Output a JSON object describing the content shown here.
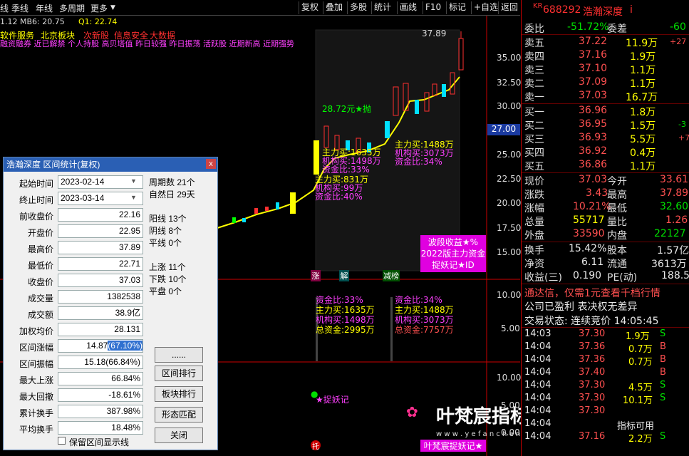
{
  "topbar": {
    "left_items": [
      "线",
      "季线",
      "年线",
      "多周期",
      "更多"
    ],
    "buttons": [
      "复权",
      "叠加",
      "多股",
      "统计",
      "画线",
      "F10",
      "标记",
      "+自选",
      "返回"
    ]
  },
  "chart": {
    "ma_line": "1.12  MB6: 20.75",
    "q1": "Q1: 22.74",
    "tags_row1": [
      "软件服务",
      "北京板块",
      "次新股",
      "信息安全",
      "大数据"
    ],
    "tags_row2": "融资融券 近已解禁 个人持股 高贝塔值 昨日较强 昨日振荡 活跃股 近期新高 近期强势",
    "price_axis": [
      "35.00",
      "32.50",
      "30.00",
      "27.00",
      "25.00",
      "22.50",
      "20.00",
      "17.50",
      "15.00"
    ],
    "high_label": "37.89",
    "mid_label": "28.72元★抛",
    "ann_main_left": [
      "主力买:1635万",
      "机构买:1498万",
      "资金比:33%"
    ],
    "ann_main_left2": [
      "主力买:831万",
      "机构买:99万",
      "资金比:40%"
    ],
    "ann_main_right": [
      "主力买:1488万",
      "机构买:3073万",
      "资金比:34%"
    ],
    "promo_box": [
      "波段收益★%",
      "2022版主力资金",
      "捉妖记★ID"
    ],
    "signal_labels": [
      "涨",
      "解",
      "减榜"
    ],
    "vol_axis": [
      "10.00",
      "5.00"
    ],
    "ann_vol_left": [
      "资金比:33%",
      "主力买:1635万",
      "机构买:1498万",
      "总资金:2995万"
    ],
    "ann_vol_right": [
      "资金比:34%",
      "主力买:1488万",
      "机构买:3073万",
      "总资金:7757万"
    ],
    "ind_axis": [
      "10.00",
      "5.00",
      "0.00"
    ],
    "ind_label": "★捉妖记",
    "ind_bottom": "叶梵宸捉妖记★",
    "watermark": "叶梵宸指标公式网",
    "watermark_url": "w w w . y e f a n c h e n . c o m",
    "ind_tag": "托"
  },
  "dialog": {
    "title": "浩瀚深度 区间统计(复权)",
    "close": "x",
    "start_label": "起始时间",
    "start_value": "2023-02-14",
    "end_label": "终止时间",
    "end_value": "2023-03-14",
    "fields": [
      {
        "label": "前收盘价",
        "value": "22.16"
      },
      {
        "label": "开盘价",
        "value": "22.95"
      },
      {
        "label": "最高价",
        "value": "37.89"
      },
      {
        "label": "最低价",
        "value": "22.71"
      },
      {
        "label": "收盘价",
        "value": "37.03"
      },
      {
        "label": "成交量",
        "value": "1382538"
      },
      {
        "label": "成交额",
        "value": "38.9亿"
      },
      {
        "label": "加权均价",
        "value": "28.131"
      },
      {
        "label": "区间涨幅",
        "value": "14.87",
        "extra": "(67.10%)"
      },
      {
        "label": "区间振幅",
        "value": "15.18(66.84%)"
      },
      {
        "label": "最大上涨",
        "value": "66.84%"
      },
      {
        "label": "最大回撤",
        "value": "-18.61%"
      },
      {
        "label": "累计换手",
        "value": "387.98%"
      },
      {
        "label": "平均换手",
        "value": "18.48%"
      }
    ],
    "stats": [
      "周期数 21个",
      "自然日 29天",
      "阳线 13个",
      "阴线 8个",
      "平线 0个",
      "上涨 11个",
      "下跌 10个",
      "平盘 0个"
    ],
    "buttons": [
      "......",
      "区间排行",
      "板块排行",
      "形态匹配",
      "关闭"
    ],
    "checkbox": "保留区间显示线"
  },
  "quote": {
    "code": "688292",
    "name": "浩瀚深度",
    "kr": "KR",
    "weibi_label": "委比",
    "weibi": "-51.72%",
    "weicha_label": "委差",
    "weicha": "-60",
    "asks": [
      {
        "l": "卖五",
        "p": "37.22",
        "v": "11.9万",
        "c": "+27"
      },
      {
        "l": "卖四",
        "p": "37.16",
        "v": "1.9万",
        "c": ""
      },
      {
        "l": "卖三",
        "p": "37.10",
        "v": "1.1万",
        "c": ""
      },
      {
        "l": "卖二",
        "p": "37.09",
        "v": "1.1万",
        "c": ""
      },
      {
        "l": "卖一",
        "p": "37.03",
        "v": "16.7万",
        "c": ""
      }
    ],
    "bids": [
      {
        "l": "买一",
        "p": "36.96",
        "v": "1.8万",
        "c": ""
      },
      {
        "l": "买二",
        "p": "36.95",
        "v": "1.5万",
        "c": "-3"
      },
      {
        "l": "买三",
        "p": "36.93",
        "v": "5.5万",
        "c": "+7"
      },
      {
        "l": "买四",
        "p": "36.92",
        "v": "0.4万",
        "c": ""
      },
      {
        "l": "买五",
        "p": "36.86",
        "v": "1.1万",
        "c": ""
      }
    ],
    "stats": [
      {
        "a": "现价",
        "av": "37.03",
        "b": "今开",
        "bv": "33.61"
      },
      {
        "a": "涨跌",
        "av": "3.43",
        "b": "最高",
        "bv": "37.89"
      },
      {
        "a": "涨幅",
        "av": "10.21%",
        "b": "最低",
        "bv": "32.60"
      },
      {
        "a": "总量",
        "av": "55717",
        "b": "量比",
        "bv": "1.26"
      },
      {
        "a": "外盘",
        "av": "33590",
        "b": "内盘",
        "bv": "22127"
      }
    ],
    "stats2": [
      {
        "a": "换手",
        "av": "15.42%",
        "b": "股本",
        "bv": "1.57亿"
      },
      {
        "a": "净资",
        "av": "6.11",
        "b": "流通",
        "bv": "3613万"
      },
      {
        "a": "收益(三)",
        "av": "0.190",
        "b": "PE(动)",
        "bv": "188.5"
      }
    ],
    "ad1": "通达信，仅需1元查看千档行情",
    "ad2": "公司已盈利 表决权无差异",
    "status": "交易状态: 连续竞价 14:05:45",
    "ticks": [
      {
        "t": "14:03",
        "p": "37.30",
        "v": "1.9万",
        "s": "S"
      },
      {
        "t": "14:04",
        "p": "37.36",
        "v": "0.7万",
        "s": "B"
      },
      {
        "t": "14:04",
        "p": "37.36",
        "v": "0.7万",
        "s": "B"
      },
      {
        "t": "14:04",
        "p": "37.40",
        "v": "",
        "s": "B"
      },
      {
        "t": "14:04",
        "p": "37.30",
        "v": "4.5万",
        "s": "S"
      },
      {
        "t": "14:04",
        "p": "37.30",
        "v": "10.1万",
        "s": "S"
      },
      {
        "t": "14:04",
        "p": "37.30",
        "v": "",
        "s": ""
      },
      {
        "t": "14:04",
        "p": "",
        "v": "指标可用",
        "s": ""
      },
      {
        "t": "14:04",
        "p": "37.16",
        "v": "2.2万",
        "s": "S"
      }
    ]
  }
}
